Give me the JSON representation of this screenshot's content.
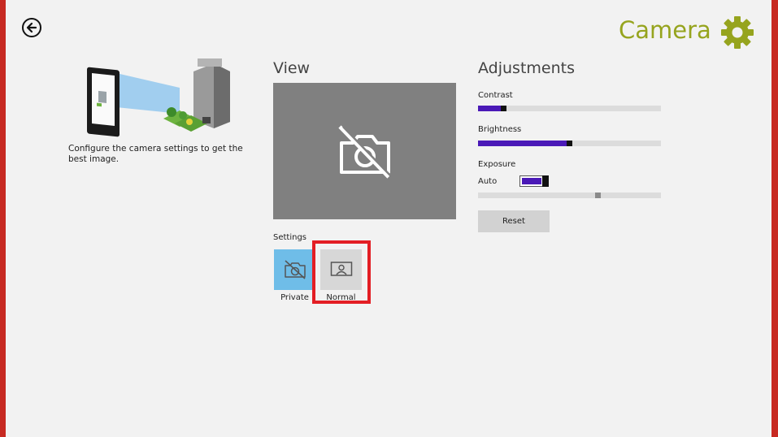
{
  "header": {
    "title": "Camera",
    "accent_color": "#96a41e",
    "back_icon": "back-arrow-icon",
    "settings_icon": "gear-icon"
  },
  "intro": {
    "description": "Configure the camera settings to get the best image."
  },
  "view": {
    "heading": "View",
    "preview_icon": "camera-off-icon"
  },
  "settings": {
    "heading": "Settings",
    "options": [
      {
        "label": "Private",
        "icon": "camera-off-icon",
        "selected": true
      },
      {
        "label": "Normal",
        "icon": "person-picture-icon",
        "selected": false
      }
    ]
  },
  "adjustments": {
    "heading": "Adjustments",
    "contrast": {
      "label": "Contrast",
      "value": 0.13
    },
    "brightness": {
      "label": "Brightness",
      "value": 0.5
    },
    "exposure": {
      "label": "Exposure",
      "auto_label": "Auto",
      "auto_on": true,
      "value": 0.66
    },
    "reset_label": "Reset",
    "slider_color": "#4a19b7"
  }
}
